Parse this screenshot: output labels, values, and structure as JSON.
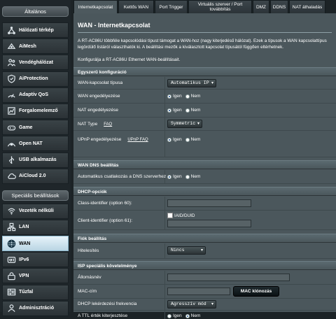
{
  "sidebar": {
    "general_header": "Általános",
    "general_items": [
      {
        "label": "Hálózati térkép",
        "icon": "network-map-icon"
      },
      {
        "label": "AiMesh",
        "icon": "aimesh-icon"
      },
      {
        "label": "Vendéghálózat",
        "icon": "guest-network-icon"
      },
      {
        "label": "AiProtection",
        "icon": "shield-icon"
      },
      {
        "label": "Adaptív QoS",
        "icon": "qos-icon"
      },
      {
        "label": "Forgalomelemző",
        "icon": "traffic-analyzer-icon"
      },
      {
        "label": "Game",
        "icon": "gamepad-icon"
      },
      {
        "label": "Open NAT",
        "icon": "open-nat-icon"
      },
      {
        "label": "USB alkalmazás",
        "icon": "usb-icon"
      },
      {
        "label": "AiCloud 2.0",
        "icon": "cloud-icon"
      }
    ],
    "advanced_header": "Speciális beállítások",
    "advanced_items": [
      {
        "label": "Vezeték nélküli",
        "icon": "wireless-icon"
      },
      {
        "label": "LAN",
        "icon": "lan-icon"
      },
      {
        "label": "WAN",
        "icon": "wan-globe-icon",
        "active": true
      },
      {
        "label": "IPv6",
        "icon": "ipv6-icon"
      },
      {
        "label": "VPN",
        "icon": "vpn-icon"
      },
      {
        "label": "Tűzfal",
        "icon": "firewall-icon"
      },
      {
        "label": "Adminisztráció",
        "icon": "admin-icon"
      }
    ]
  },
  "tabs": [
    {
      "label": "Internetkapcsolat",
      "active": true
    },
    {
      "label": "Kettős WAN"
    },
    {
      "label": "Port Trigger"
    },
    {
      "label": "Virtuális szerver / Port továbbítás"
    },
    {
      "label": "DMZ"
    },
    {
      "label": "DDNS"
    },
    {
      "label": "NAT áthaladás"
    }
  ],
  "page": {
    "title": "WAN - Internetkapcsolat",
    "desc1": "A RT-AC86U többféle kapcsolódási típust támogat a WAN-hoz (nagy kiterjedésű hálózat). Ezek a típusok a WAN kapcsolattípus legördülő listáról választhatók ki. A beállítási mezők a kiválasztott kapcsolat típusától függően eltérhetnek.",
    "desc2": "Konfigurálja a RT-AC86U Ethernet WAN-beállításait."
  },
  "sections": {
    "basic": "Egyszerű konfiguráció",
    "dns": "WAN DNS beállítás",
    "dhcp": "DHCP-opciók",
    "account": "Fiók beállítás",
    "isp": "ISP speciális követelménye"
  },
  "fields": {
    "wan_type_label": "WAN-kapcsolat típusa",
    "wan_type_value": "Automatikus IP",
    "wan_enable_label": "WAN engedélyezése",
    "nat_enable_label": "NAT engedélyezése",
    "nat_type_label": "NAT Type",
    "nat_type_link": "FAQ",
    "nat_type_value": "Symmetric",
    "upnp_label": "UPnP engedélyezése",
    "upnp_link": "UPnP  FAQ",
    "dns_auto_label": "Automatikus csatlakozás a DNS szerverhez",
    "class_id_label": "Class-identifier (option 60):",
    "client_id_label": "Client-identifier (option 61):",
    "iaid_label": "IAID/DUID",
    "auth_label": "Hitelesítés",
    "auth_value": "Nincs",
    "hostname_label": "Állomásnév",
    "mac_label": "MAC-cím",
    "mac_clone_button": "MAC klónozás",
    "dhcp_freq_label": "DHCP lekérdezési frekvencia",
    "dhcp_freq_value": "Agresszív mód",
    "ttl_label": "A TTL érték kiterjesztése"
  },
  "radio": {
    "yes": "Igen",
    "no": "Nem"
  }
}
